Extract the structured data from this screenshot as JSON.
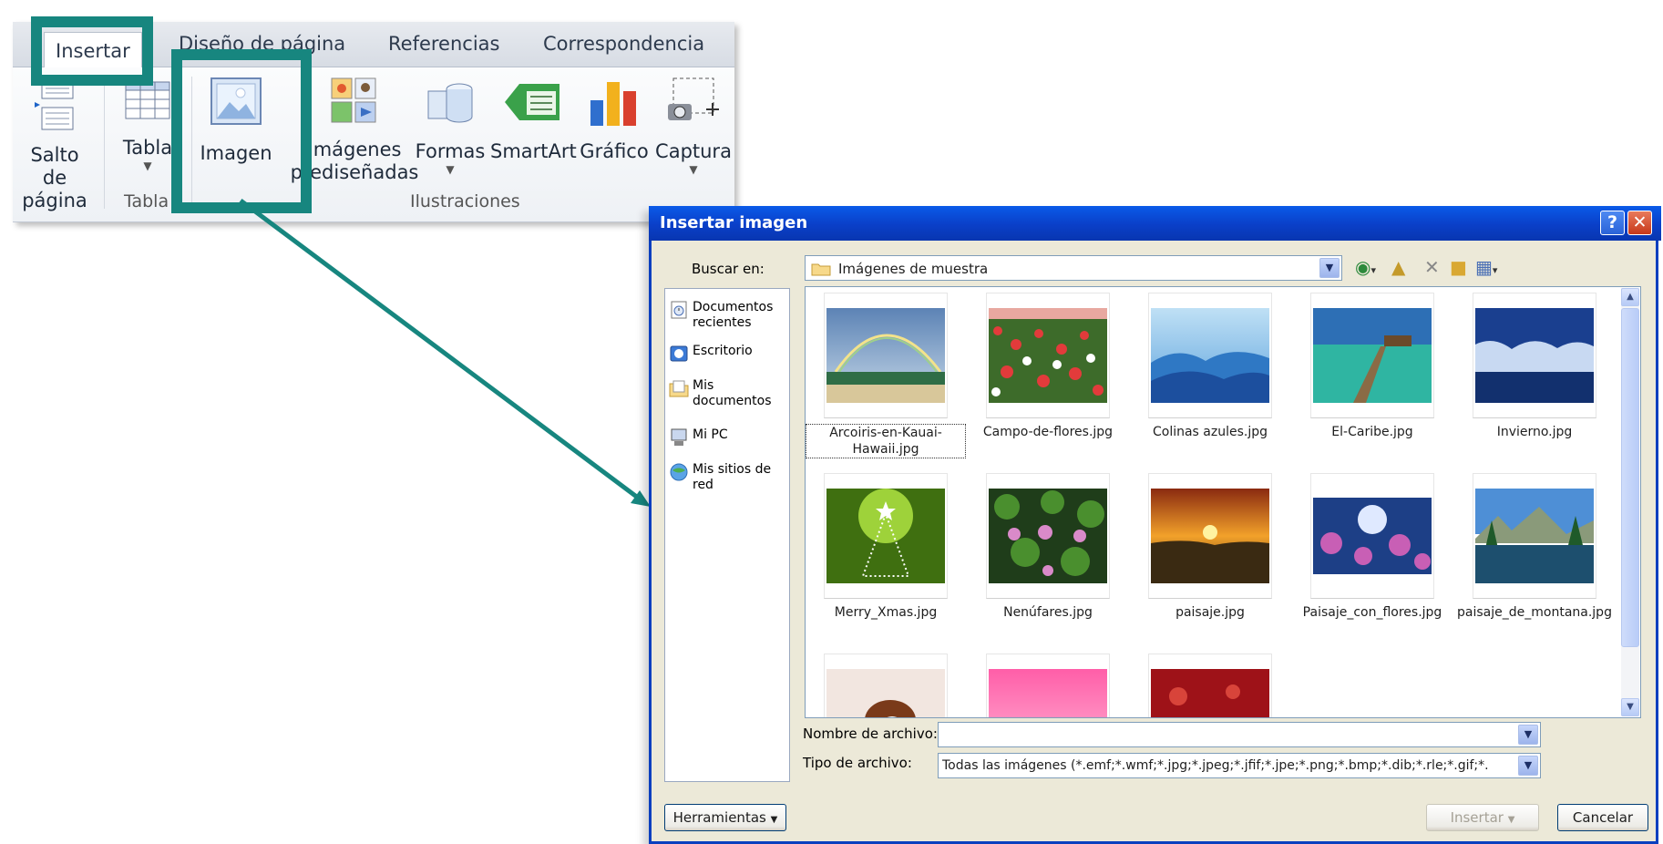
{
  "ribbon": {
    "tabs": [
      "Insertar",
      "Diseño de página",
      "Referencias",
      "Correspondencia"
    ],
    "buttons": {
      "salto": "Salto de página",
      "tabla": "Tabla",
      "imagen": "Imagen",
      "imagenes_pred": "Imágenes prediseñadas",
      "formas": "Formas",
      "smartart": "SmartArt",
      "grafico": "Gráfico",
      "captura": "Captura"
    },
    "groups": {
      "tablas": "Tabla",
      "ilustraciones": "Ilustraciones"
    }
  },
  "dialog": {
    "title": "Insertar imagen",
    "help": "?",
    "close": "✕",
    "lookin_label": "Buscar en:",
    "lookin_value": "Imágenes de muestra",
    "places": [
      {
        "label": "Documentos recientes",
        "icon": "recent-documents-icon"
      },
      {
        "label": "Escritorio",
        "icon": "desktop-icon"
      },
      {
        "label": "Mis documentos",
        "icon": "my-documents-icon"
      },
      {
        "label": "Mi PC",
        "icon": "my-computer-icon"
      },
      {
        "label": "Mis sitios de red",
        "icon": "network-places-icon"
      }
    ],
    "files": [
      {
        "name": "Arcoiris-en-Kauai-Hawaii.jpg",
        "selected": true
      },
      {
        "name": "Campo-de-flores.jpg"
      },
      {
        "name": "Colinas azules.jpg"
      },
      {
        "name": "El-Caribe.jpg"
      },
      {
        "name": "Invierno.jpg"
      },
      {
        "name": "Merry_Xmas.jpg"
      },
      {
        "name": "Nenúfares.jpg"
      },
      {
        "name": "paisaje.jpg"
      },
      {
        "name": "Paisaje_con_flores.jpg"
      },
      {
        "name": "paisaje_de_montana.jpg"
      }
    ],
    "filename_label": "Nombre de archivo:",
    "filename_value": "",
    "filetype_label": "Tipo de archivo:",
    "filetype_value": "Todas las imágenes (*.emf;*.wmf;*.jpg;*.jpeg;*.jfif;*.jpe;*.png;*.bmp;*.dib;*.rle;*.gif;*.",
    "tools_button": "Herramientas",
    "insert_button": "Insertar",
    "cancel_button": "Cancelar"
  },
  "colors": {
    "highlight": "#17867f",
    "titlebar": "#0a46d8"
  }
}
